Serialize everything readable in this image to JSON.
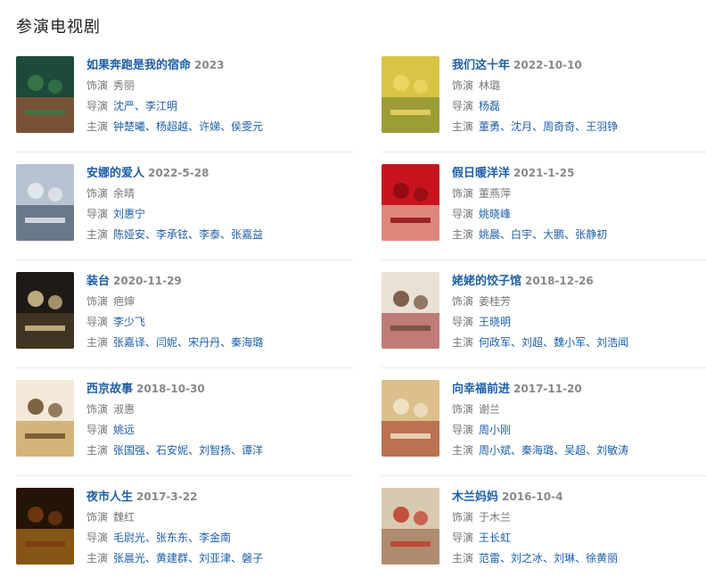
{
  "section": {
    "title": "参演电视剧"
  },
  "labels": {
    "role": "饰演",
    "director": "导演",
    "cast": "主演"
  },
  "shows": [
    {
      "title": "如果奔跑是我的宿命",
      "date": "2023",
      "role": "秀丽",
      "directors": [
        "沈严",
        "李江明"
      ],
      "cast": [
        "钟楚曦",
        "杨超越",
        "许娣",
        "侯雯元"
      ],
      "poster_colors": [
        "#1d4a3a",
        "#c25a35",
        "#3c7a4a"
      ]
    },
    {
      "title": "我们这十年",
      "date": "2022-10-10",
      "role": "林璐",
      "directors": [
        "杨磊"
      ],
      "cast": [
        "董勇",
        "沈月",
        "周奇奇",
        "王羽铮"
      ],
      "poster_colors": [
        "#d9c446",
        "#6a7d2a",
        "#f0d86a"
      ]
    },
    {
      "title": "安娜的爱人",
      "date": "2022-5-28",
      "role": "余晴",
      "directors": [
        "刘惠宁"
      ],
      "cast": [
        "陈娅安",
        "李承铉",
        "李泰",
        "张嘉益"
      ],
      "poster_colors": [
        "#b7c3d0",
        "#2b3b52",
        "#e8ecf0"
      ]
    },
    {
      "title": "假日暖洋洋",
      "date": "2021-1-25",
      "role": "董燕萍",
      "directors": [
        "姚晓峰"
      ],
      "cast": [
        "姚晨",
        "白宇",
        "大鹏",
        "张静初"
      ],
      "poster_colors": [
        "#c8141e",
        "#f2e4c8",
        "#8a0b12"
      ]
    },
    {
      "title": "装台",
      "date": "2020-11-29",
      "role": "疤婶",
      "directors": [
        "李少飞"
      ],
      "cast": [
        "张嘉译",
        "闫妮",
        "宋丹丹",
        "秦海璐"
      ],
      "poster_colors": [
        "#1f1a16",
        "#5a4a30",
        "#d8c690"
      ]
    },
    {
      "title": "姥姥的饺子馆",
      "date": "2018-12-26",
      "role": "姜桂芳",
      "directors": [
        "王晓明"
      ],
      "cast": [
        "何政军",
        "刘超",
        "魏小军",
        "刘浩闻"
      ],
      "poster_colors": [
        "#e9e1d6",
        "#a0282a",
        "#6b4a34"
      ]
    },
    {
      "title": "西京故事",
      "date": "2018-10-30",
      "role": "淑惠",
      "directors": [
        "姚远"
      ],
      "cast": [
        "张国强",
        "石安妮",
        "刘智扬",
        "谭洋"
      ],
      "poster_colors": [
        "#f3e9d8",
        "#b9892e",
        "#6a4b2a"
      ]
    },
    {
      "title": "向幸福前进",
      "date": "2017-11-20",
      "role": "谢兰",
      "directors": [
        "周小刚"
      ],
      "cast": [
        "周小斌",
        "秦海璐",
        "吴超",
        "刘敏涛"
      ],
      "poster_colors": [
        "#dcbf8c",
        "#a3321f",
        "#f1e6c9"
      ]
    },
    {
      "title": "夜市人生",
      "date": "2017-3-22",
      "role": "魏红",
      "directors": [
        "毛尉光",
        "张东东",
        "李金南"
      ],
      "cast": [
        "张晨光",
        "黄建群",
        "刘亚津",
        "磐子"
      ],
      "poster_colors": [
        "#241408",
        "#d68a22",
        "#7a3a12"
      ]
    },
    {
      "title": "木兰妈妈",
      "date": "2016-10-4",
      "role": "于木兰",
      "directors": [
        "王长虹"
      ],
      "cast": [
        "范雷",
        "刘之冰",
        "刘琳",
        "徐黄丽"
      ],
      "poster_colors": [
        "#d9c9b0",
        "#8a5a3a",
        "#c0392b"
      ]
    }
  ]
}
